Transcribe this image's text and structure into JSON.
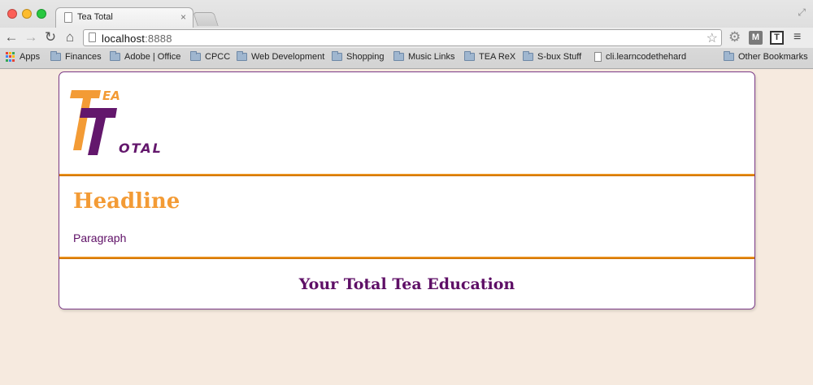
{
  "browser": {
    "tab_title": "Tea Total",
    "tab_close": "×",
    "url_host": "localhost",
    "url_port": ":8888",
    "bookmarks": [
      {
        "label": "Apps",
        "icon": "apps-grid-icon"
      },
      {
        "label": "Finances",
        "icon": "folder-icon"
      },
      {
        "label": "Adobe | Office",
        "icon": "folder-icon"
      },
      {
        "label": "CPCC",
        "icon": "folder-icon"
      },
      {
        "label": "Web Development",
        "icon": "folder-icon"
      },
      {
        "label": "Shopping",
        "icon": "folder-icon"
      },
      {
        "label": "Music Links",
        "icon": "folder-icon"
      },
      {
        "label": "TEA ReX",
        "icon": "folder-icon"
      },
      {
        "label": "S-bux Stuff",
        "icon": "folder-icon"
      },
      {
        "label": "cli.learncodethehard",
        "icon": "page-icon"
      },
      {
        "label": "Other Bookmarks",
        "icon": "folder-icon"
      }
    ]
  },
  "page": {
    "logo_text_top": "EA",
    "logo_text_bottom": "OTAL",
    "headline": "Headline",
    "paragraph": "Paragraph",
    "footer_title": "Your Total Tea Education"
  },
  "colors": {
    "accent_orange": "#f39b35",
    "brand_purple": "#5e0f66",
    "page_background": "#f6eadf"
  }
}
